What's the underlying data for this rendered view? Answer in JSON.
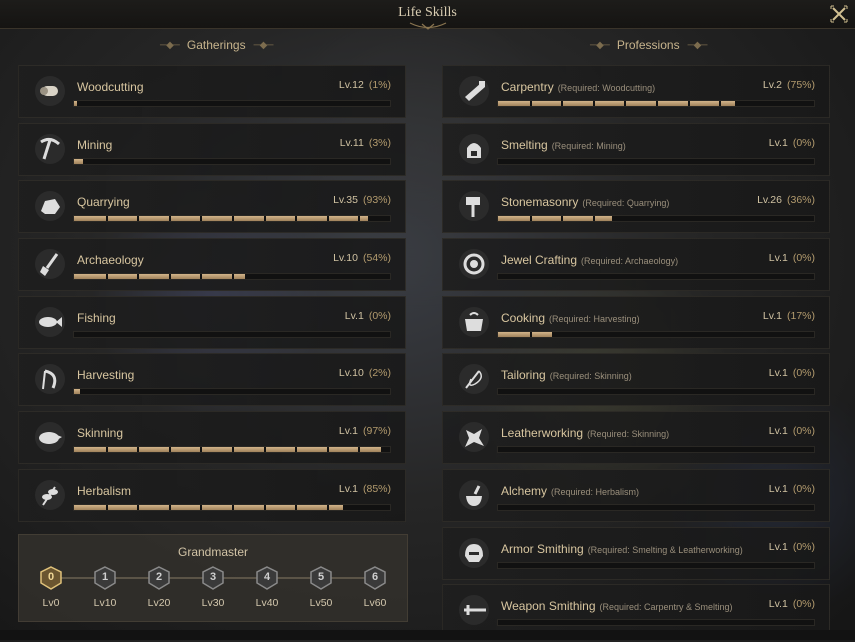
{
  "window": {
    "title": "Life Skills",
    "close_icon": "close-x-icon"
  },
  "gatherings": {
    "header": "Gatherings",
    "skills": [
      {
        "name": "Woodcutting",
        "level": "Lv.12",
        "percent": "(1%)",
        "progress": 0.01,
        "icon": "log-icon"
      },
      {
        "name": "Mining",
        "level": "Lv.11",
        "percent": "(3%)",
        "progress": 0.03,
        "icon": "pickaxe-icon"
      },
      {
        "name": "Quarrying",
        "level": "Lv.35",
        "percent": "(93%)",
        "progress": 0.93,
        "icon": "stone-icon"
      },
      {
        "name": "Archaeology",
        "level": "Lv.10",
        "percent": "(54%)",
        "progress": 0.54,
        "icon": "shovel-icon"
      },
      {
        "name": "Fishing",
        "level": "Lv.1",
        "percent": "(0%)",
        "progress": 0.0,
        "icon": "fish-icon"
      },
      {
        "name": "Harvesting",
        "level": "Lv.10",
        "percent": "(2%)",
        "progress": 0.02,
        "icon": "sickle-icon"
      },
      {
        "name": "Skinning",
        "level": "Lv.1",
        "percent": "(97%)",
        "progress": 0.97,
        "icon": "boar-icon"
      },
      {
        "name": "Herbalism",
        "level": "Lv.1",
        "percent": "(85%)",
        "progress": 0.85,
        "icon": "herb-icon"
      }
    ]
  },
  "professions": {
    "header": "Professions",
    "skills": [
      {
        "name": "Carpentry",
        "req": "(Required: Woodcutting)",
        "level": "Lv.2",
        "percent": "(75%)",
        "progress": 0.75,
        "icon": "saw-icon"
      },
      {
        "name": "Smelting",
        "req": "(Required: Mining)",
        "level": "Lv.1",
        "percent": "(0%)",
        "progress": 0.0,
        "icon": "furnace-icon"
      },
      {
        "name": "Stonemasonry",
        "req": "(Required: Quarrying)",
        "level": "Lv.26",
        "percent": "(36%)",
        "progress": 0.36,
        "icon": "mallet-icon"
      },
      {
        "name": "Jewel Crafting",
        "req": "(Required: Archaeology)",
        "level": "Lv.1",
        "percent": "(0%)",
        "progress": 0.0,
        "icon": "gem-icon"
      },
      {
        "name": "Cooking",
        "req": "(Required: Harvesting)",
        "level": "Lv.1",
        "percent": "(17%)",
        "progress": 0.17,
        "icon": "pot-icon"
      },
      {
        "name": "Tailoring",
        "req": "(Required: Skinning)",
        "level": "Lv.1",
        "percent": "(0%)",
        "progress": 0.0,
        "icon": "needle-icon"
      },
      {
        "name": "Leatherworking",
        "req": "(Required: Skinning)",
        "level": "Lv.1",
        "percent": "(0%)",
        "progress": 0.0,
        "icon": "hide-icon"
      },
      {
        "name": "Alchemy",
        "req": "(Required: Herbalism)",
        "level": "Lv.1",
        "percent": "(0%)",
        "progress": 0.0,
        "icon": "flask-icon"
      },
      {
        "name": "Armor Smithing",
        "req": "(Required: Smelting & Leatherworking)",
        "level": "Lv.1",
        "percent": "(0%)",
        "progress": 0.0,
        "icon": "helmet-icon"
      },
      {
        "name": "Weapon Smithing",
        "req": "(Required: Carpentry & Smelting)",
        "level": "Lv.1",
        "percent": "(0%)",
        "progress": 0.0,
        "icon": "sword-icon"
      }
    ]
  },
  "grandmaster": {
    "title": "Grandmaster",
    "current_tier": 0,
    "tiers": [
      {
        "num": "0",
        "label": "Lv0"
      },
      {
        "num": "1",
        "label": "Lv10"
      },
      {
        "num": "2",
        "label": "Lv20"
      },
      {
        "num": "3",
        "label": "Lv30"
      },
      {
        "num": "4",
        "label": "Lv40"
      },
      {
        "num": "5",
        "label": "Lv50"
      },
      {
        "num": "6",
        "label": "Lv60"
      }
    ]
  },
  "colors": {
    "bar_fill": "#c4a47a",
    "accent_gold": "#d8b77a",
    "panel_bg": "#1e1e1e"
  }
}
